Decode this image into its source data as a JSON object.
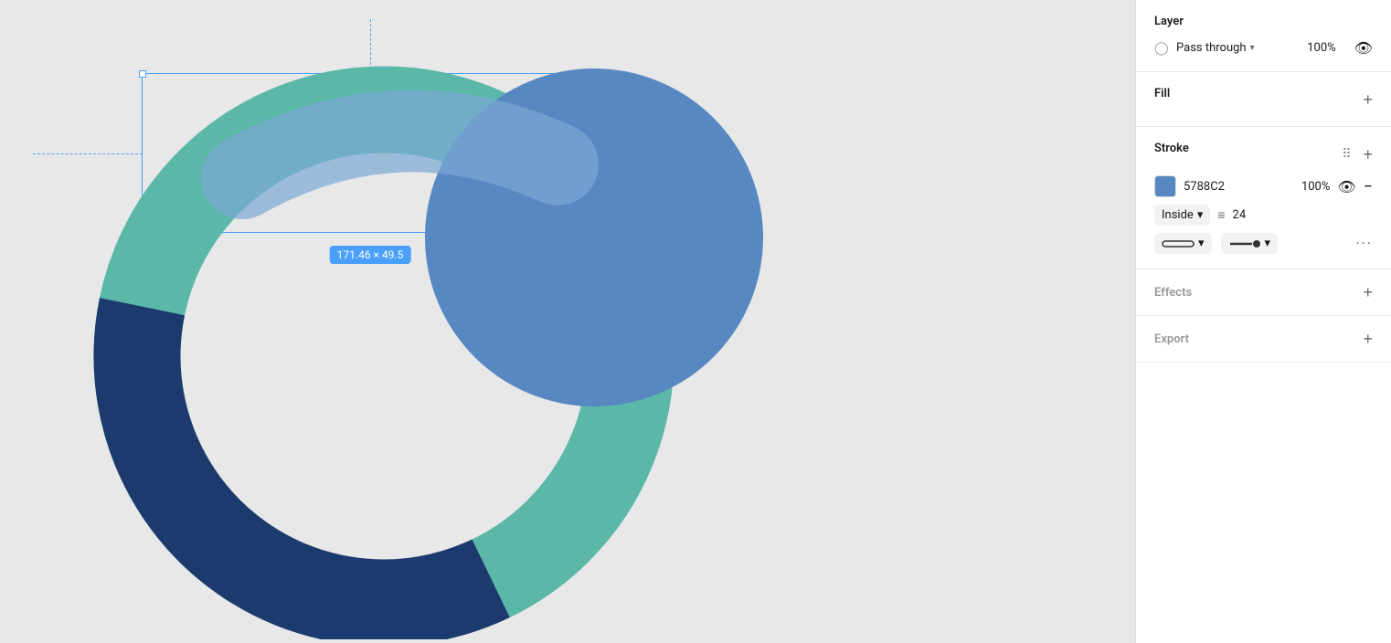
{
  "panel": {
    "layer": {
      "title": "Layer",
      "blend_mode": "Pass through",
      "opacity": "100%",
      "visibility_icon": "👁"
    },
    "fill": {
      "title": "Fill",
      "add_label": "+"
    },
    "stroke": {
      "title": "Stroke",
      "color_hex": "5788C2",
      "opacity": "100%",
      "position": "Inside",
      "width": "24",
      "add_label": "+",
      "more_label": "···"
    },
    "effects": {
      "title": "Effects",
      "add_label": "+"
    },
    "export": {
      "title": "Export",
      "add_label": "+"
    }
  },
  "canvas": {
    "dimension_label": "171.46 × 49.5"
  },
  "colors": {
    "teal": "#5BB8A8",
    "dark_blue": "#1D3A6E",
    "medium_blue": "#5788C2",
    "selection_blue": "#4AA0F8"
  }
}
